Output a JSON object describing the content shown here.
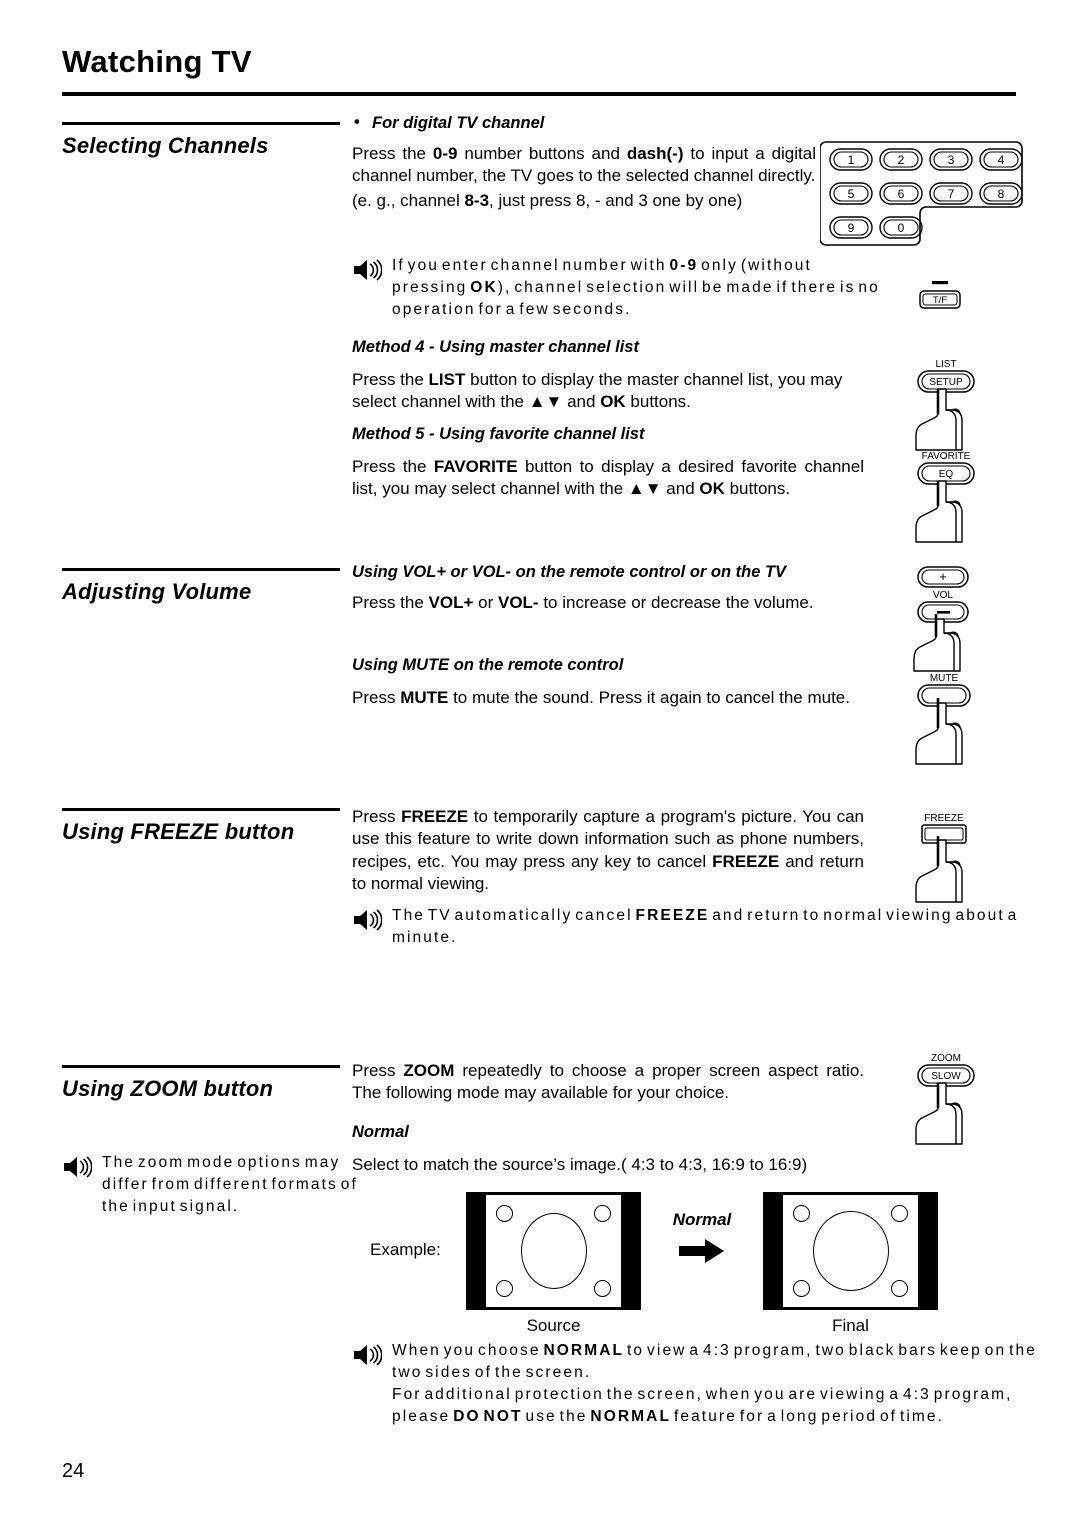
{
  "page": {
    "title": "Watching TV",
    "number": "24"
  },
  "sections": [
    {
      "heading": "Selecting Channels",
      "bullet_head": "For digital TV channel",
      "paragraphs": [
        "Press the 0-9 number buttons and dash(-) to input a digital channel number, the TV goes to the selected channel directly.",
        "(e. g., channel 8-3, just press 8, - and 3 one by one)"
      ],
      "note": "If you enter channel number with 0-9 only (without pressing OK), channel selection will be made if there is no operation for a few seconds.",
      "method4_head": "Method 4 - Using master channel list",
      "method4_body": "Press the LIST button to display the master channel list, you may select channel with the ▲▼ and OK buttons.",
      "method5_head": "Method 5 - Using favorite channel list",
      "method5_body": "Press the FAVORITE button to display a desired favorite channel list, you may select channel with the ▲▼ and OK buttons."
    },
    {
      "heading": "Adjusting Volume",
      "vol_head": "Using VOL+ or VOL- on the remote control or on the TV",
      "vol_body": "Press the VOL+ or VOL- to increase or decrease the volume.",
      "mute_head": "Using MUTE on the remote control",
      "mute_body": "Press MUTE to mute the sound. Press it again to cancel the mute."
    },
    {
      "heading": "Using FREEZE button",
      "body": "Press FREEZE to temporarily capture a program's picture. You can use this feature to write down information such as phone numbers, recipes, etc. You may press any key to cancel FREEZE and return to normal viewing.",
      "note": "The TV automatically cancel FREEZE and return to normal viewing about a minute."
    },
    {
      "heading": "Using ZOOM button",
      "body": "Press ZOOM repeatedly to choose a proper screen aspect ratio. The following mode may available for your choice.",
      "mode_head": "Normal",
      "mode_body": "Select to match the source’s image.( 4:3 to 4:3, 16:9 to 16:9)",
      "left_note": "The zoom mode options may differ from different formats of the input signal.",
      "bottom_note_line1": "When you choose NORMAL to view a 4:3 program, two black bars keep on the two sides of the screen.",
      "bottom_note_line2": "For additional protection the screen, when you are viewing a 4:3 program, please DO NOT use the NORMAL feature for a long period of time."
    }
  ],
  "figure": {
    "example_label": "Example:",
    "arrow_label": "Normal",
    "source_caption": "Source",
    "final_caption": "Final"
  },
  "remote": {
    "keypad": [
      "1",
      "2",
      "3",
      "4",
      "5",
      "6",
      "7",
      "8",
      "9",
      "0"
    ],
    "dash_button": "T/F",
    "list_top": "LIST",
    "list_main": "SETUP",
    "favorite_top": "FAVORITE",
    "favorite_main": "EQ",
    "vol_plus": "+",
    "vol_label": "VOL",
    "vol_minus": "–",
    "mute_label": "MUTE",
    "freeze_label": "FREEZE",
    "zoom_top": "ZOOM",
    "zoom_main": "SLOW"
  }
}
